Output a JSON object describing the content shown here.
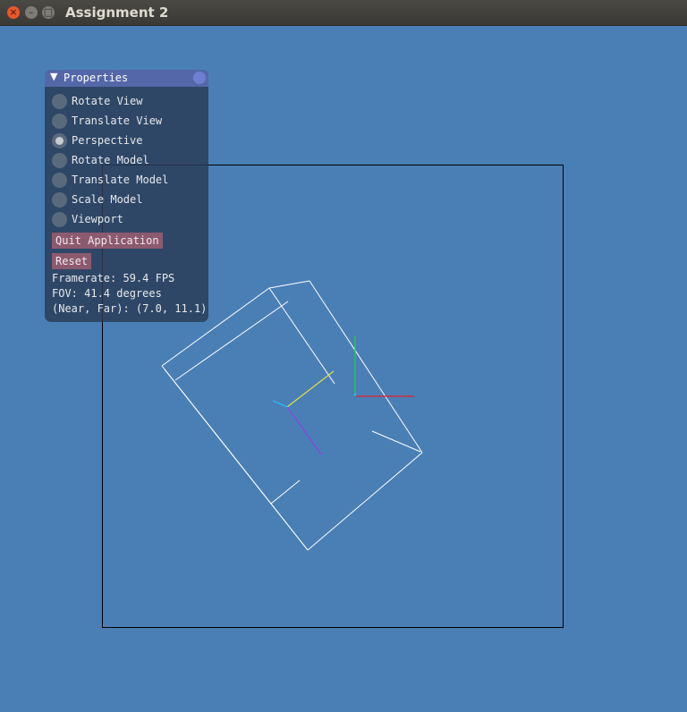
{
  "window": {
    "title": "Assignment 2"
  },
  "panel": {
    "title": "Properties",
    "modes": [
      {
        "label": "Rotate View",
        "checked": false
      },
      {
        "label": "Translate View",
        "checked": false
      },
      {
        "label": "Perspective",
        "checked": true
      },
      {
        "label": "Rotate Model",
        "checked": false
      },
      {
        "label": "Translate Model",
        "checked": false
      },
      {
        "label": "Scale Model",
        "checked": false
      },
      {
        "label": "Viewport",
        "checked": false
      }
    ],
    "quit_label": "Quit Application",
    "reset_label": "Reset",
    "framerate_text": "Framerate: 59.4 FPS",
    "fov_text": "FOV: 41.4 degrees",
    "nearfar_text": "(Near, Far): (7.0, 11.1)"
  },
  "colors": {
    "background": "#4a7fb6",
    "wireframe": "#ffffff",
    "viewport_border": "#000000",
    "axis_x": "#e0202a",
    "axis_y": "#20d040",
    "axis_z": "#20c8ff",
    "model_axis_x": "#e0e040",
    "model_axis_y": "#9040e0",
    "model_axis_z": "#20c8ff"
  }
}
